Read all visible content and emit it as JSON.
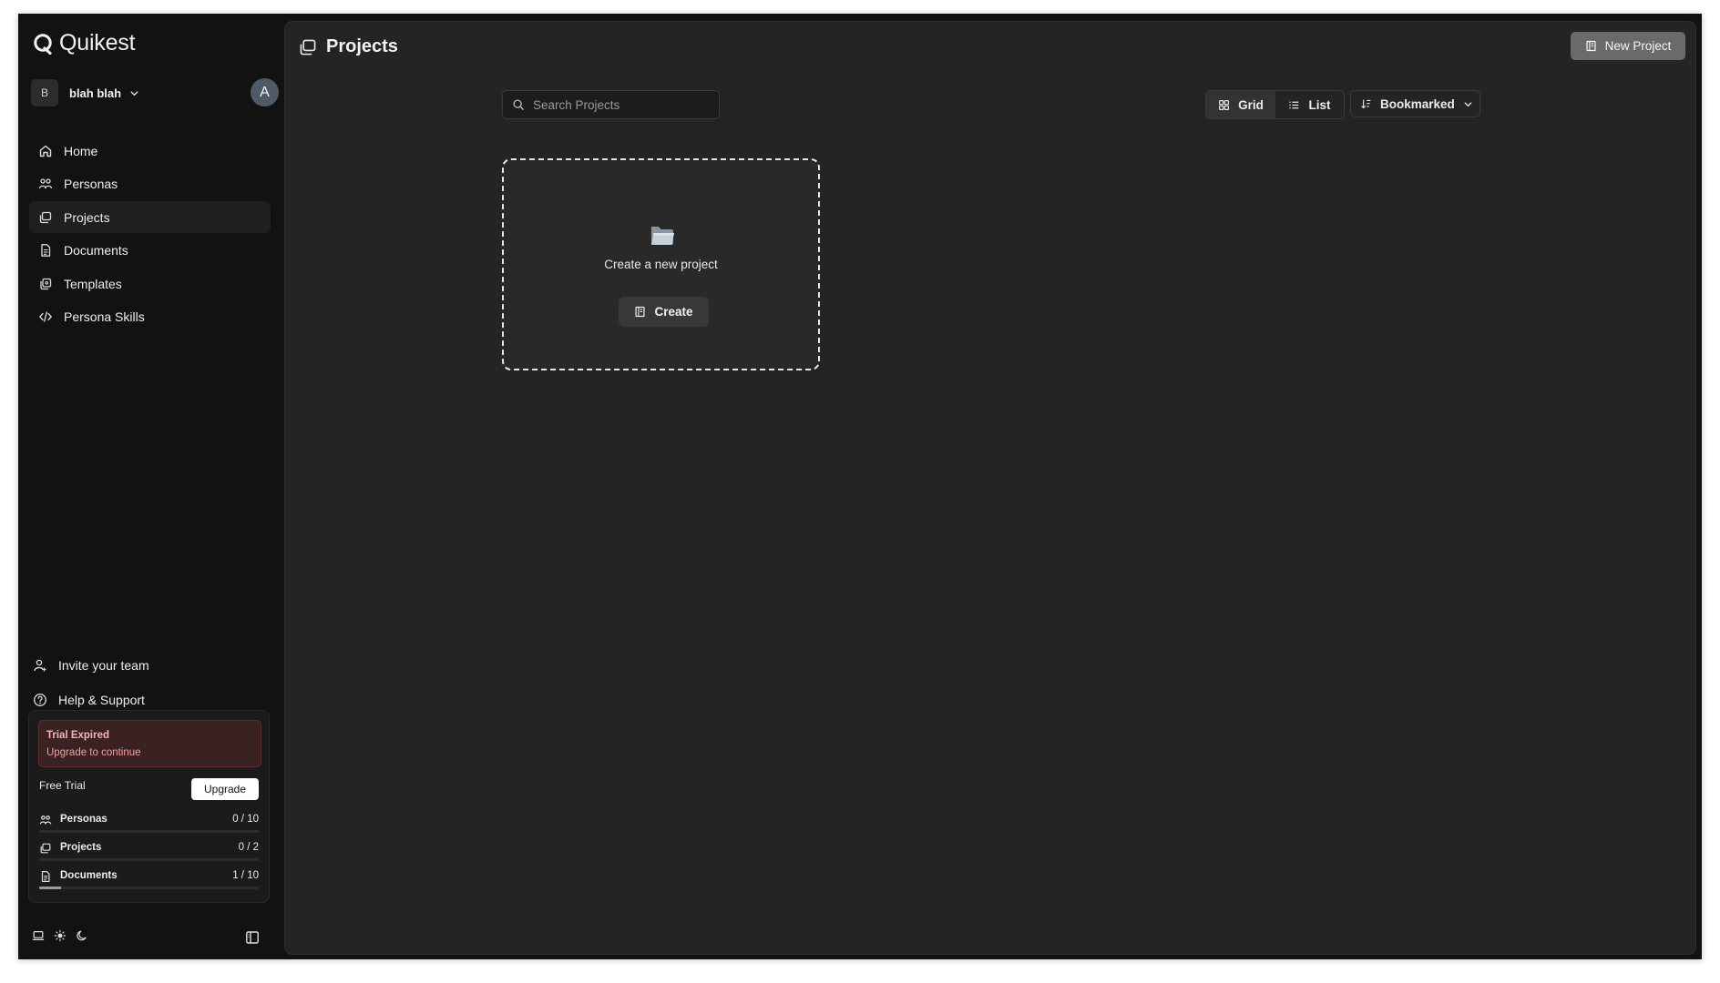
{
  "app": {
    "name": "Quikest"
  },
  "workspace": {
    "badge": "B",
    "name": "blah blah",
    "avatar": "A"
  },
  "sidebar": {
    "items": [
      {
        "label": "Home",
        "icon": "home-icon"
      },
      {
        "label": "Personas",
        "icon": "users-icon"
      },
      {
        "label": "Projects",
        "icon": "projects-icon",
        "active": true
      },
      {
        "label": "Documents",
        "icon": "document-icon"
      },
      {
        "label": "Templates",
        "icon": "templates-icon"
      },
      {
        "label": "Persona Skills",
        "icon": "code-icon"
      }
    ],
    "bottom": [
      {
        "label": "Invite your team",
        "icon": "user-plus-icon"
      },
      {
        "label": "Help & Support",
        "icon": "help-icon"
      }
    ]
  },
  "plan": {
    "alert_title": "Trial Expired",
    "alert_subtitle": "Upgrade to continue",
    "name": "Free Trial",
    "upgrade_label": "Upgrade",
    "usage": [
      {
        "label": "Personas",
        "value": "0 / 10",
        "fraction": 0.0
      },
      {
        "label": "Projects",
        "value": "0 / 2",
        "fraction": 0.0
      },
      {
        "label": "Documents",
        "value": "1 / 10",
        "fraction": 0.1
      }
    ]
  },
  "header": {
    "title": "Projects",
    "new_project_label": "New Project"
  },
  "toolbar": {
    "search_placeholder": "Search Projects",
    "view_grid": "Grid",
    "view_list": "List",
    "active_view": "Grid",
    "sort_label": "Bookmarked"
  },
  "empty_card": {
    "title": "Create a new project",
    "create_label": "Create"
  },
  "colors": {
    "sidebar_bg": "#121212",
    "main_bg": "#242424",
    "alert_bg": "#3a2222",
    "alert_text": "#f0a0a0"
  }
}
